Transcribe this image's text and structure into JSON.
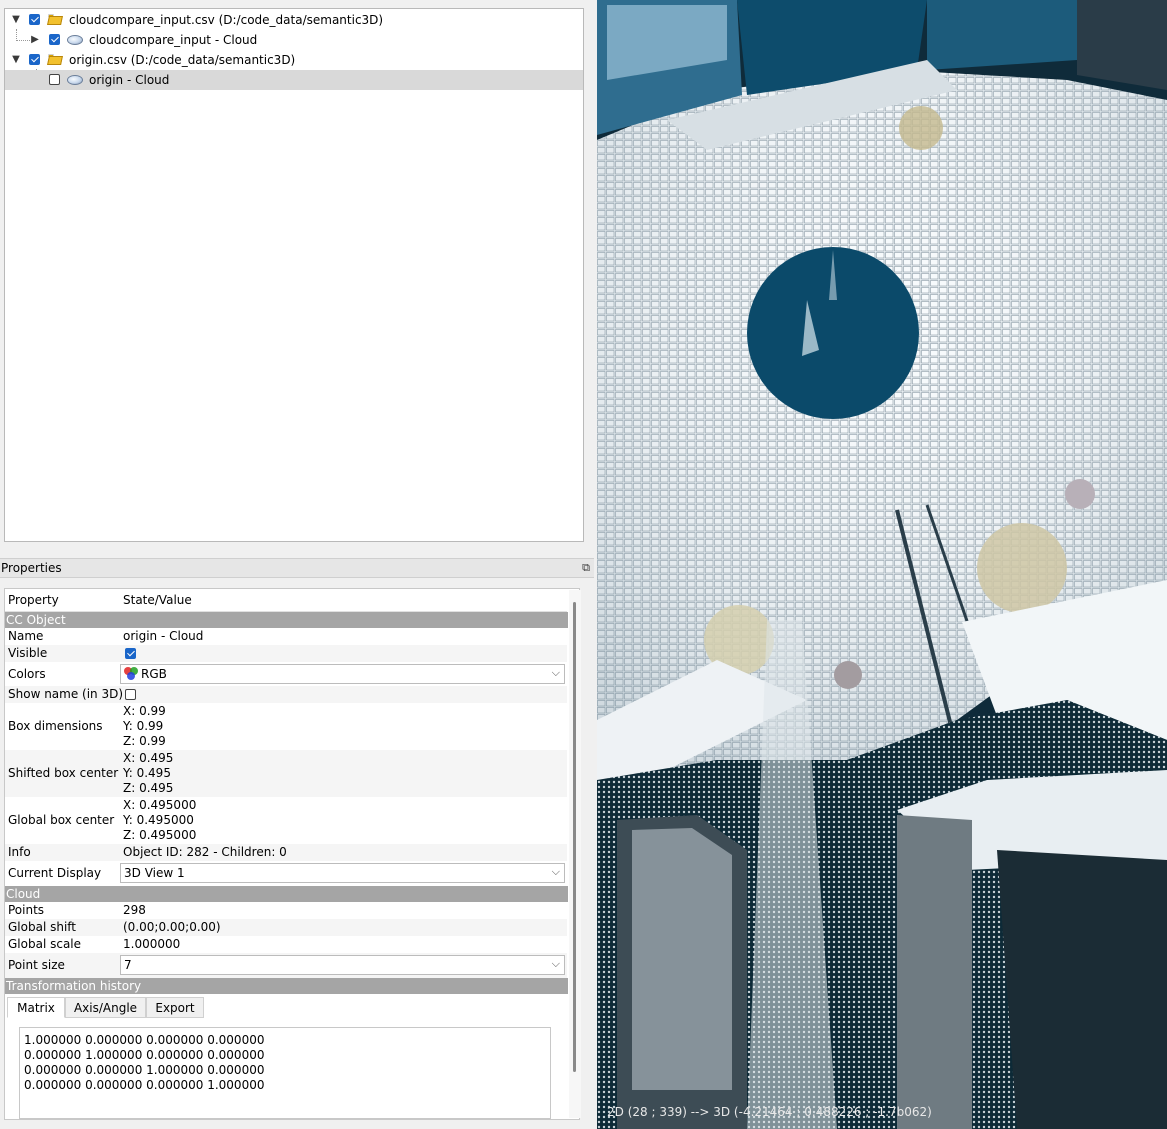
{
  "tree": {
    "items": [
      {
        "label": "cloudcompare_input.csv (D:/code_data/semantic3D)"
      },
      {
        "label": "cloudcompare_input - Cloud"
      },
      {
        "label": "origin.csv (D:/code_data/semantic3D)"
      },
      {
        "label": "origin - Cloud"
      }
    ]
  },
  "properties": {
    "title": "Properties",
    "header": {
      "property": "Property",
      "value": "State/Value"
    },
    "sections": {
      "cc_object": "CC Object",
      "cloud": "Cloud",
      "transformation": "Transformation history"
    },
    "rows": {
      "name": {
        "label": "Name",
        "value": "origin - Cloud"
      },
      "visible": {
        "label": "Visible"
      },
      "colors": {
        "label": "Colors",
        "value": "RGB"
      },
      "show_name": {
        "label": "Show name (in 3D)"
      },
      "box_dimensions": {
        "label": "Box dimensions",
        "x": "X: 0.99",
        "y": "Y: 0.99",
        "z": "Z: 0.99"
      },
      "shifted_box_center": {
        "label": "Shifted box center",
        "x": "X: 0.495",
        "y": "Y: 0.495",
        "z": "Z: 0.495"
      },
      "global_box_center": {
        "label": "Global box center",
        "x": "X: 0.495000",
        "y": "Y: 0.495000",
        "z": "Z: 0.495000"
      },
      "info": {
        "label": "Info",
        "value": "Object ID: 282 - Children: 0"
      },
      "current_display": {
        "label": "Current Display",
        "value": "3D View 1"
      },
      "points": {
        "label": "Points",
        "value": "298"
      },
      "global_shift": {
        "label": "Global shift",
        "value": "(0.00;0.00;0.00)"
      },
      "global_scale": {
        "label": "Global scale",
        "value": "1.000000"
      },
      "point_size": {
        "label": "Point size",
        "value": "7"
      }
    },
    "tabs": [
      "Matrix",
      "Axis/Angle",
      "Export"
    ],
    "matrix": [
      "1.000000 0.000000 0.000000 0.000000",
      "0.000000 1.000000 0.000000 0.000000",
      "0.000000 0.000000 1.000000 0.000000",
      "0.000000 0.000000 0.000000 1.000000"
    ]
  },
  "view": {
    "status": "2D (28 ; 339) --> 3D (-4.21464 ; 0.488226 ; -1.7b062)",
    "colors": {
      "sky_disc": "#0b4a6a",
      "pavement": "#e4ecf0",
      "background": "#0f2b3a"
    }
  }
}
